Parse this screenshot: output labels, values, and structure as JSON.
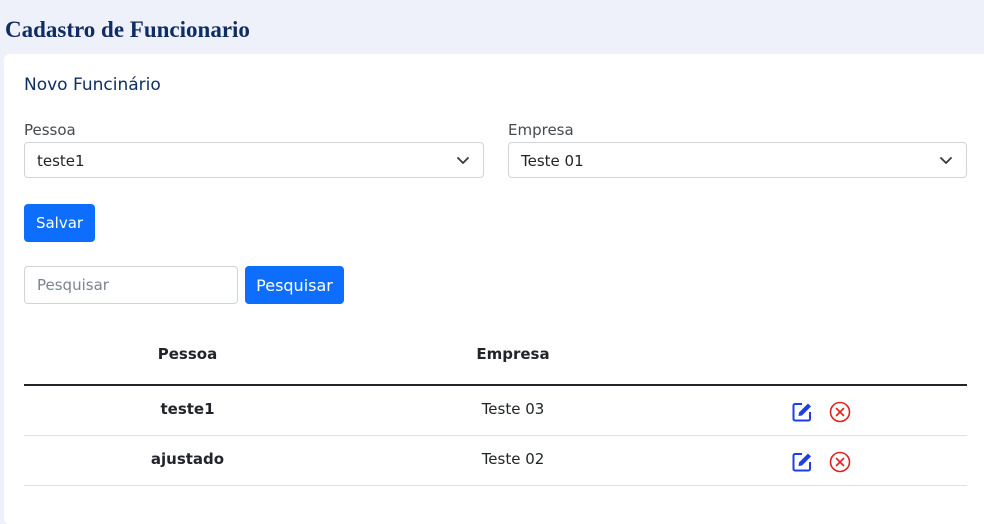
{
  "header": {
    "title": "Cadastro de Funcionario"
  },
  "form": {
    "title": "Novo Funcinário",
    "pessoa": {
      "label": "Pessoa",
      "value": "teste1"
    },
    "empresa": {
      "label": "Empresa",
      "value": "Teste 01"
    },
    "save_label": "Salvar"
  },
  "search": {
    "placeholder": "Pesquisar",
    "value": "",
    "button_label": "Pesquisar"
  },
  "table": {
    "columns": [
      "Pessoa",
      "Empresa"
    ],
    "rows": [
      {
        "pessoa": "teste1",
        "empresa": "Teste 03"
      },
      {
        "pessoa": "ajustado",
        "empresa": "Teste 02"
      }
    ]
  },
  "icons": {
    "edit": "edit-icon",
    "delete": "delete-icon",
    "select": "chevron-down-icon"
  },
  "colors": {
    "primary": "#0d6efd",
    "title": "#0f2d63",
    "edit": "#1f3ee6",
    "delete": "#e02020"
  }
}
